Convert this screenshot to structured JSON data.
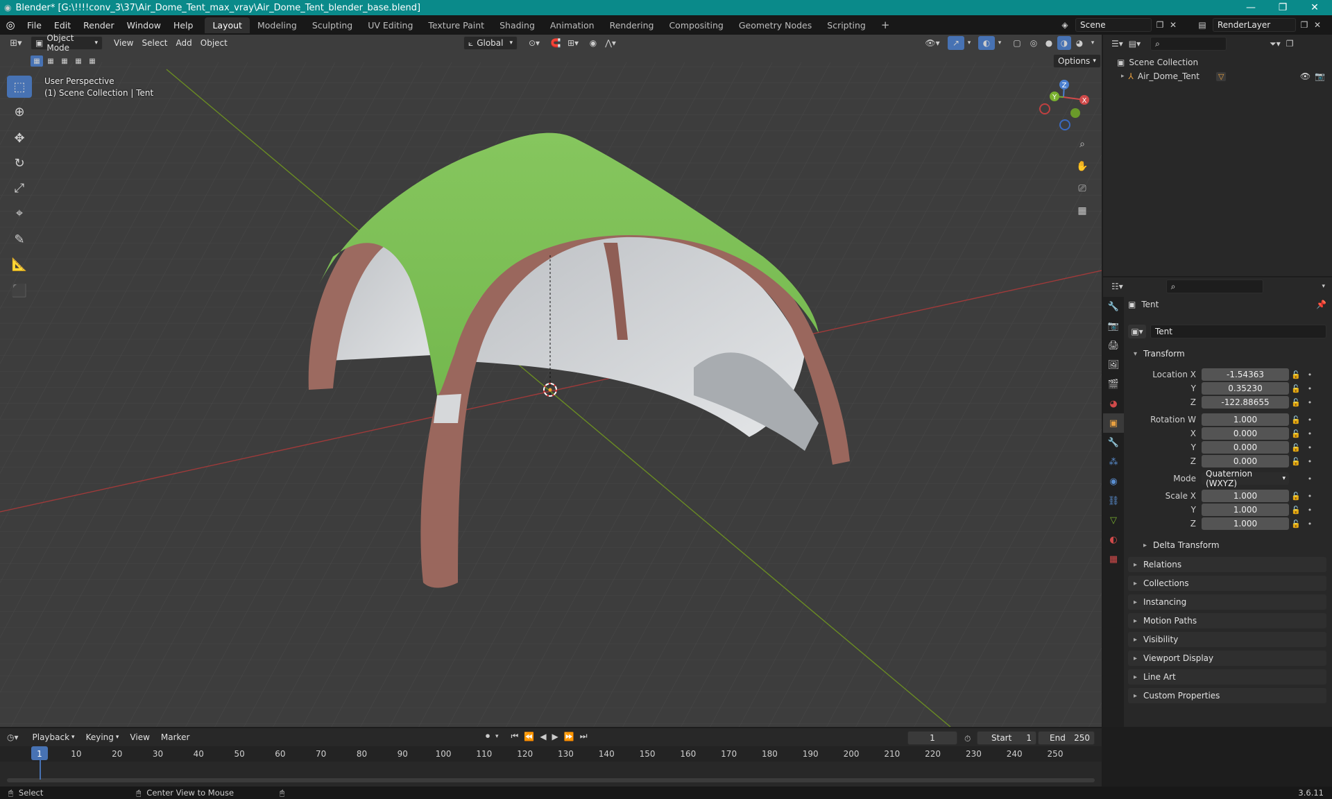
{
  "titlebar": {
    "title": "Blender* [G:\\!!!!conv_3\\37\\Air_Dome_Tent_max_vray\\Air_Dome_Tent_blender_base.blend]",
    "minimize": "—",
    "maximize": "❐",
    "close": "✕"
  },
  "menubar": {
    "items": [
      "File",
      "Edit",
      "Render",
      "Window",
      "Help"
    ],
    "workspaces": [
      "Layout",
      "Modeling",
      "Sculpting",
      "UV Editing",
      "Texture Paint",
      "Shading",
      "Animation",
      "Rendering",
      "Compositing",
      "Geometry Nodes",
      "Scripting"
    ],
    "active_workspace": "Layout",
    "add_tab": "+",
    "scene": "Scene",
    "view_layer": "RenderLayer"
  },
  "viewport_header": {
    "mode": "Object Mode",
    "menus": [
      "View",
      "Select",
      "Add",
      "Object"
    ],
    "orientation": "Global",
    "options": "Options"
  },
  "viewport": {
    "perspective": "User Perspective",
    "collection_info": "(1) Scene Collection | Tent",
    "gizmo_axes": {
      "x": "X",
      "y": "Y",
      "z": "Z"
    },
    "colors": {
      "background": "#3c3c3c",
      "grid": "#464646",
      "x_axis": "#a03838",
      "y_axis": "#6a8c23",
      "tent_green": "#7fc35a",
      "tent_frame": "#9c6a60",
      "tent_wall": "#c8cacc"
    }
  },
  "outliner": {
    "root": "Scene Collection",
    "items": [
      {
        "name": "Air_Dome_Tent"
      }
    ]
  },
  "properties": {
    "object_name": "Tent",
    "datablock_name": "Tent",
    "transform_header": "Transform",
    "location": {
      "label_x": "Location X",
      "label_y": "Y",
      "label_z": "Z",
      "x": "-1.54363",
      "y": "0.35230",
      "z": "-122.88655"
    },
    "rotation": {
      "label_w": "Rotation W",
      "label_x": "X",
      "label_y": "Y",
      "label_z": "Z",
      "w": "1.000",
      "x": "0.000",
      "y": "0.000",
      "z": "0.000"
    },
    "mode": {
      "label": "Mode",
      "value": "Quaternion (WXYZ)"
    },
    "scale": {
      "label_x": "Scale X",
      "label_y": "Y",
      "label_z": "Z",
      "x": "1.000",
      "y": "1.000",
      "z": "1.000"
    },
    "delta_transform": "Delta Transform",
    "panels": [
      "Relations",
      "Collections",
      "Instancing",
      "Motion Paths",
      "Visibility",
      "Viewport Display",
      "Line Art",
      "Custom Properties"
    ]
  },
  "timeline": {
    "menus": [
      "Playback",
      "Keying",
      "View",
      "Marker"
    ],
    "current_frame": "1",
    "start_label": "Start",
    "start": "1",
    "end_label": "End",
    "end": "250",
    "ticks": [
      "1",
      "10",
      "20",
      "30",
      "40",
      "50",
      "60",
      "70",
      "80",
      "90",
      "100",
      "110",
      "120",
      "130",
      "140",
      "150",
      "160",
      "170",
      "180",
      "190",
      "200",
      "210",
      "220",
      "230",
      "240",
      "250"
    ]
  },
  "statusbar": {
    "select": "Select",
    "center_view": "Center View to Mouse",
    "version": "3.6.11"
  }
}
